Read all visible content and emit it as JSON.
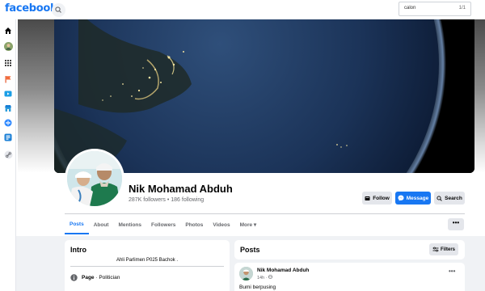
{
  "app": {
    "logo": "facebook"
  },
  "find_bar": {
    "query": "calon",
    "count": "1/1"
  },
  "rail": {
    "icons": [
      "home-icon",
      "avatar-icon",
      "grid-menu-icon",
      "flag-icon",
      "watch-icon",
      "marketplace-icon",
      "gaming-icon",
      "feeds-icon",
      "link-icon"
    ]
  },
  "profile": {
    "name": "Nik Mohamad Abduh",
    "stats": "287K followers • 186 following"
  },
  "actions": {
    "follow": "Follow",
    "message": "Message",
    "search": "Search"
  },
  "tabs": [
    {
      "label": "Posts",
      "active": true
    },
    {
      "label": "About"
    },
    {
      "label": "Mentions"
    },
    {
      "label": "Followers"
    },
    {
      "label": "Photos"
    },
    {
      "label": "Videos"
    },
    {
      "label": "More ▾"
    }
  ],
  "more_menu": "•••",
  "intro": {
    "title": "Intro",
    "bio": "Ahli Parlimen P025 Bachok .",
    "page_label": "Page",
    "page_category": " · Politician"
  },
  "posts": {
    "title": "Posts",
    "filters": "Filters",
    "first": {
      "author": "Nik Mohamad Abduh",
      "time": "14h · ",
      "text": "Bumi berpusing",
      "menu": "•••"
    }
  },
  "colors": {
    "brand": "#1877f2",
    "surface": "#ffffff",
    "background": "#f0f2f5"
  }
}
